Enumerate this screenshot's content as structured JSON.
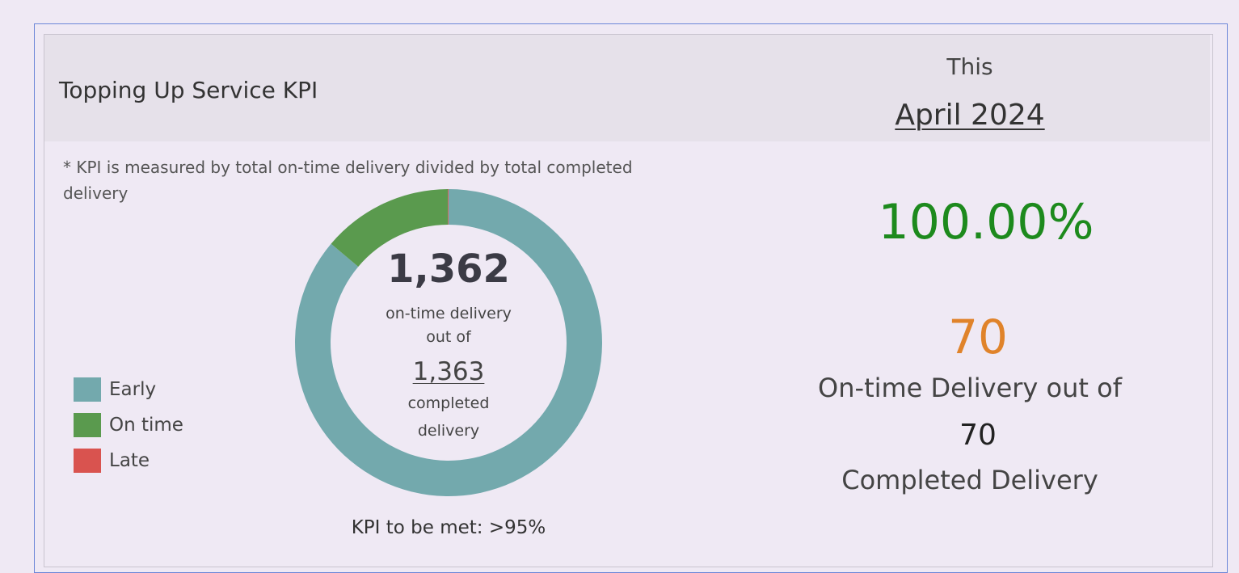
{
  "header": {
    "title": "Topping Up Service KPI",
    "period_prefix": "This",
    "period": "April 2024"
  },
  "note": "* KPI is measured by total on-time delivery divided by total completed delivery",
  "donut_center": {
    "count": "1,362",
    "line1": "on-time delivery",
    "line2": "out of",
    "total": "1,363",
    "line3": "completed",
    "line4": "delivery"
  },
  "kpi_target": "KPI to be met: >95%",
  "right_panel": {
    "kpi_percent": "100.00%",
    "ontime_count": "70",
    "ontime_label": "On-time Delivery out of",
    "completed_count": "70",
    "completed_label": "Completed Delivery"
  },
  "colors": {
    "early": "#73a9ad",
    "on_time": "#5a9a4e",
    "late": "#d9534f",
    "kpi_percent": "#1d8a1d",
    "ontime_count": "#e0832a"
  },
  "chart_data": {
    "type": "pie",
    "style": "donut",
    "categories": [
      "Early",
      "On time",
      "Late"
    ],
    "values": [
      1174,
      188,
      1
    ],
    "legend": [
      "Early",
      "On time",
      "Late"
    ],
    "legend_placement": "left"
  }
}
